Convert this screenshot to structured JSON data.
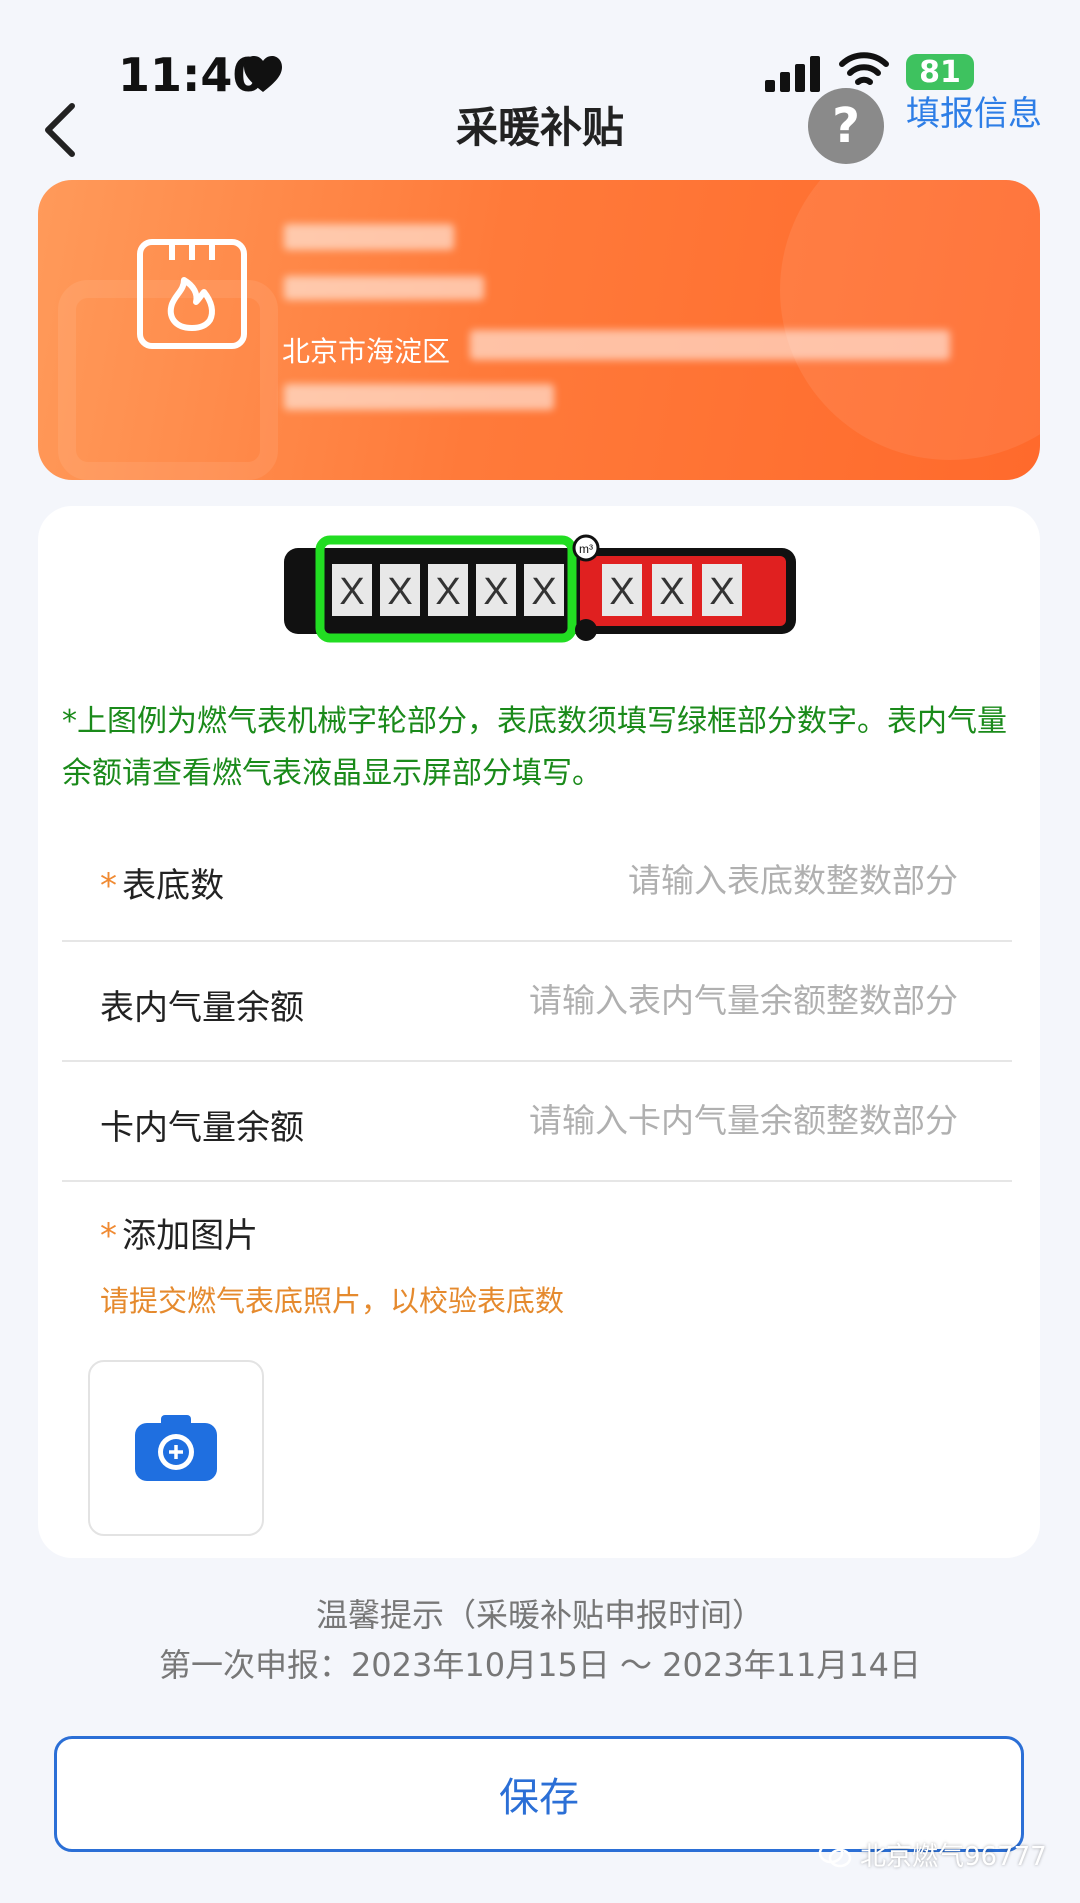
{
  "status_bar": {
    "time": "11:40",
    "battery": "81"
  },
  "nav": {
    "title": "采暖补贴",
    "help": "?",
    "fill_info": "填报信息"
  },
  "account_card": {
    "address_prefix": "北京市海淀区"
  },
  "meter_example": {
    "unit": "m³",
    "integer_digits": [
      "X",
      "X",
      "X",
      "X",
      "X"
    ],
    "decimal_digits": [
      "X",
      "X",
      "X"
    ],
    "colors": {
      "highlight": "#22dd22",
      "decimal_bg": "#e02020",
      "body": "#111111"
    }
  },
  "notice": "*上图例为燃气表机械字轮部分，表底数须填写绿框部分数字。表内气量余额请查看燃气表液晶显示屏部分填写。",
  "form": {
    "meter_reading": {
      "required": "*",
      "label": "表底数",
      "placeholder": "请输入表底数整数部分"
    },
    "meter_balance": {
      "label": "表内气量余额",
      "placeholder": "请输入表内气量余额整数部分"
    },
    "card_balance": {
      "label": "卡内气量余额",
      "placeholder": "请输入卡内气量余额整数部分"
    },
    "photo": {
      "required": "*",
      "label": "添加图片",
      "hint": "请提交燃气表底照片，以校验表底数"
    }
  },
  "tips": {
    "title": "温馨提示（采暖补贴申报时间）",
    "first_period": "第一次申报：2023年10月15日 ～ 2023年11月14日"
  },
  "save_label": "保存",
  "watermark": "北京燃气96777",
  "colors": {
    "accent": "#2b6fd6",
    "orange": "#ff7a3a",
    "hint_green": "#1a8a1a",
    "hint_orange": "#e58a2e"
  }
}
